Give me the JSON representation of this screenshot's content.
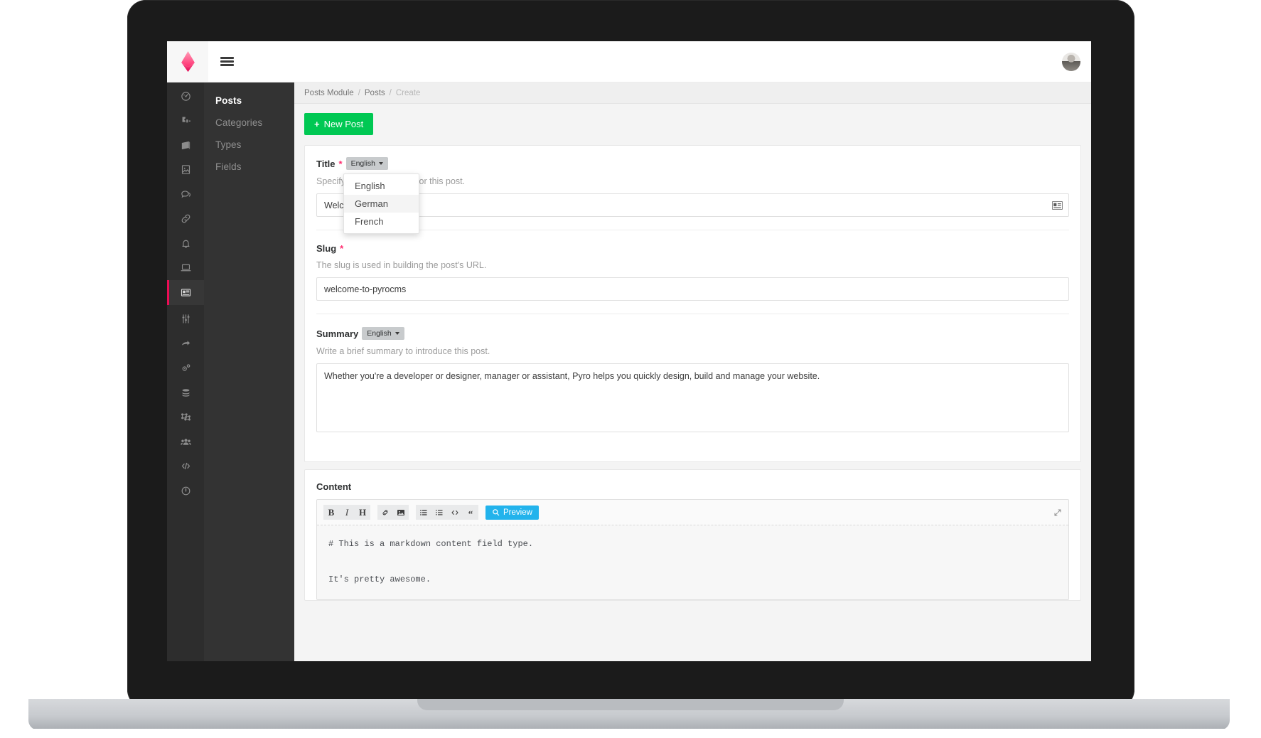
{
  "app": {
    "brand_logo": "pyrocms-flame-logo",
    "menu_icon": "hamburger-icon",
    "avatar_alt": "user-avatar"
  },
  "rail": {
    "items": [
      {
        "icon": "dashboard-icon",
        "active": false
      },
      {
        "icon": "puzzle-addons-icon",
        "active": false
      },
      {
        "icon": "pages-book-icon",
        "active": false
      },
      {
        "icon": "files-image-icon",
        "active": false
      },
      {
        "icon": "comments-icon",
        "active": false
      },
      {
        "icon": "links-chain-icon",
        "active": false
      },
      {
        "icon": "notifications-bell-icon",
        "active": false
      },
      {
        "icon": "preferences-laptop-icon",
        "active": false
      },
      {
        "icon": "posts-news-icon",
        "active": true
      },
      {
        "icon": "settings-sliders-icon",
        "active": false
      },
      {
        "icon": "redirects-arrow-icon",
        "active": false
      },
      {
        "icon": "configuration-gears-icon",
        "active": false
      },
      {
        "icon": "database-icon",
        "active": false
      },
      {
        "icon": "variables-nodes-icon",
        "active": false
      },
      {
        "icon": "users-group-icon",
        "active": false
      },
      {
        "icon": "code-icon",
        "active": false
      },
      {
        "icon": "power-icon",
        "active": false
      }
    ]
  },
  "subnav": {
    "items": [
      {
        "label": "Posts",
        "active": true
      },
      {
        "label": "Categories",
        "active": false
      },
      {
        "label": "Types",
        "active": false
      },
      {
        "label": "Fields",
        "active": false
      }
    ]
  },
  "breadcrumb": {
    "module": "Posts Module",
    "section": "Posts",
    "current": "Create",
    "separator": "/"
  },
  "toolbar": {
    "new_post_label": "New Post",
    "new_post_plus": "+",
    "new_post_color": "#00c853"
  },
  "form": {
    "title": {
      "label": "Title",
      "required_mark": "*",
      "lang_button": "English",
      "help": "Specify a descriptive title for this post.",
      "value": "Welcome to PyroCMS!",
      "placeholder": "",
      "addon_icon": "id-card-icon"
    },
    "title_dropdown": {
      "open": true,
      "options": [
        "English",
        "German",
        "French"
      ],
      "hovered": "German"
    },
    "slug": {
      "label": "Slug",
      "required_mark": "*",
      "help": "The slug is used in building the post's URL.",
      "value": "welcome-to-pyrocms",
      "placeholder": ""
    },
    "summary": {
      "label": "Summary",
      "lang_button": "English",
      "help": "Write a brief summary to introduce this post.",
      "value": "Whether you're a developer or designer, manager or assistant, Pyro helps you quickly design, build and manage your website.",
      "placeholder": ""
    },
    "content": {
      "label": "Content",
      "toolbar": {
        "bold": "B",
        "italic": "I",
        "heading": "H",
        "link_icon": "link-icon",
        "image_icon": "image-icon",
        "unordered_list_icon": "bullet-list-icon",
        "ordered_list_icon": "numbered-list-icon",
        "code_icon": "code-icon",
        "quote": "“",
        "preview_label": "Preview",
        "preview_icon": "search-icon",
        "preview_color": "#22b3ec",
        "expand_icon": "expand-icon"
      },
      "value": "# This is a markdown content field type.\n\nIt's pretty awesome."
    }
  },
  "colors": {
    "accent_pink": "#ec0d55",
    "rail_bg": "#2d2d2d",
    "subnav_bg": "#333333",
    "page_bg": "#f4f4f4"
  }
}
